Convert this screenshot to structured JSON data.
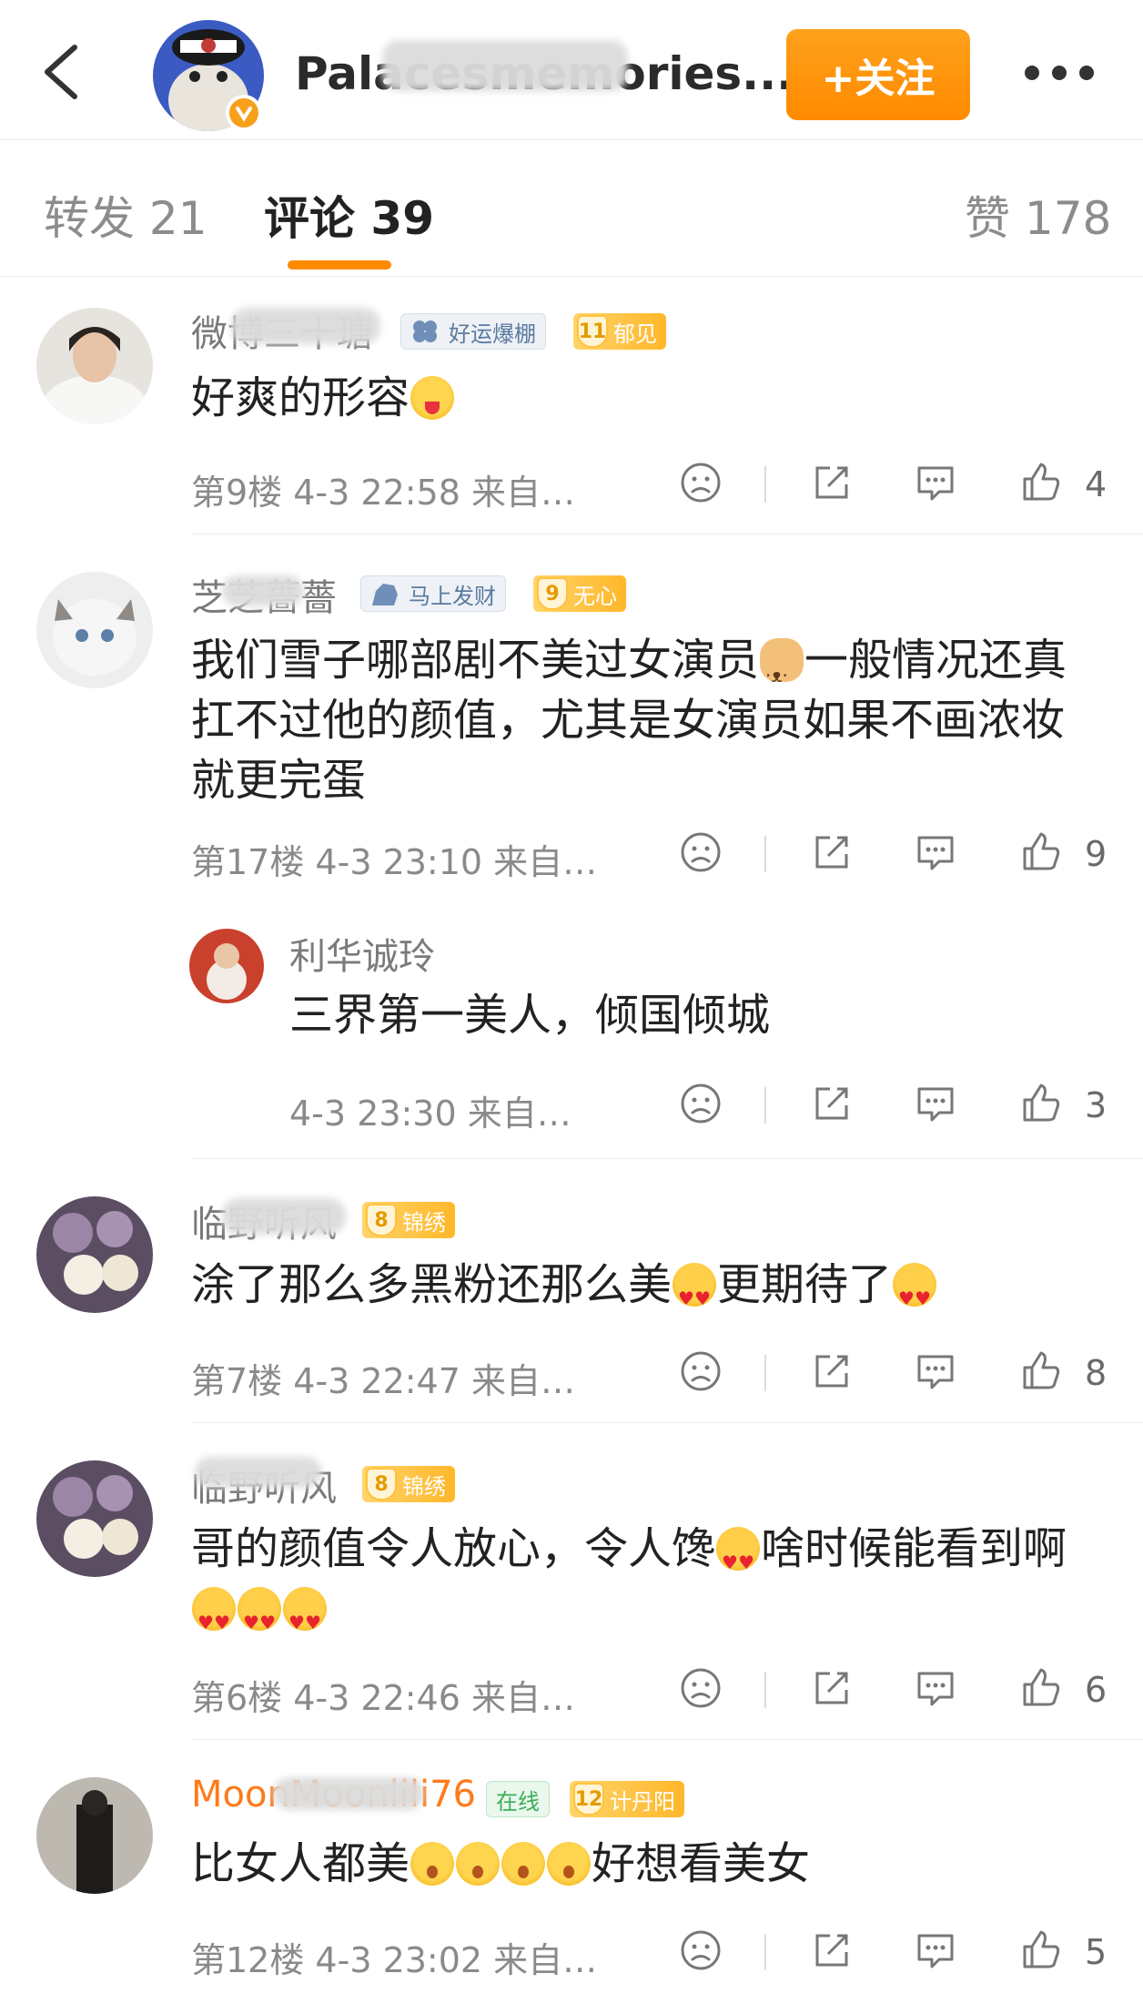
{
  "header": {
    "account_name": "Palacesmemories...",
    "follow_label": "+关注"
  },
  "tabs": {
    "repost": "转发 21",
    "comments": "评论 39",
    "likes": "赞 178"
  },
  "comments": [
    {
      "username": "微博三十瑭",
      "badges": [
        {
          "type": "grey",
          "label": "好运爆棚"
        },
        {
          "type": "gold",
          "level": "11",
          "label": "郁见"
        }
      ],
      "text": "好爽的形容",
      "emojis": [
        "yum"
      ],
      "floor_meta": "第9楼  4-3 22:58  来自…",
      "likes": "4"
    },
    {
      "username": "芝芝蔷薔",
      "badges": [
        {
          "type": "grey",
          "label": "马上发财"
        },
        {
          "type": "gold",
          "level": "9",
          "label": "无心"
        }
      ],
      "text_parts": [
        "我们雪子哪部剧不美过女演员",
        "一般情况还真扛不过他的颜值，尤其是女演员如果不画浓妆就更完蛋"
      ],
      "floor_meta": "第17楼  4-3 23:10  来自…",
      "likes": "9"
    },
    {
      "username": "利华诚玲",
      "text": "三界第一美人，倾国倾城",
      "floor_meta": "4-3 23:30  来自…",
      "likes": "3"
    },
    {
      "username": "临野听风",
      "badges": [
        {
          "type": "gold",
          "level": "8",
          "label": "锦绣"
        }
      ],
      "text_parts": [
        "涂了那么多黑粉还那么美",
        "更期待了"
      ],
      "floor_meta": "第7楼  4-3 22:47  来自…",
      "likes": "8"
    },
    {
      "username": "临野听风",
      "badges": [
        {
          "type": "gold",
          "level": "8",
          "label": "锦绣"
        }
      ],
      "text_parts": [
        "哥的颜值令人放心，令人馋",
        "啥时候能看到啊"
      ],
      "floor_meta": "第6楼  4-3 22:46  来自…",
      "likes": "6"
    },
    {
      "username": "MoonMoonlili76",
      "badges": [
        {
          "type": "green",
          "label": "在线"
        },
        {
          "type": "gold",
          "level": "12",
          "label": "计丹阳"
        }
      ],
      "text_parts": [
        "比女人都美",
        "好想看美女"
      ],
      "floor_meta": "第12楼  4-3 23:02  来自…",
      "likes": "5"
    }
  ],
  "colors": {
    "accent": "#ff8a00",
    "vip_name": "#ff7a1a",
    "meta_text": "#8a8a8a"
  },
  "icons": [
    "back-arrow-icon",
    "verified-icon",
    "more-icon",
    "dislike-face-icon",
    "share-icon",
    "comment-icon",
    "thumbs-up-icon"
  ]
}
